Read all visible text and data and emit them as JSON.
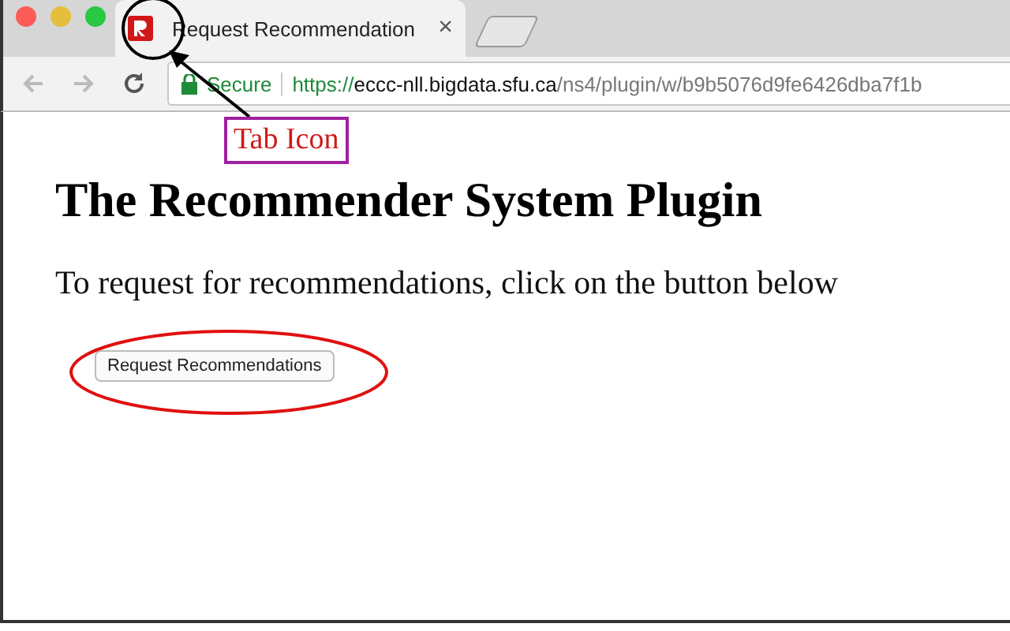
{
  "tab": {
    "title": "Request Recommendation",
    "close": "×",
    "selected": true
  },
  "address_bar": {
    "secure_label": "Secure",
    "url_scheme": "https://",
    "url_host": "eccc-nll.bigdata.sfu.ca",
    "url_path": "/ns4/plugin/w/b9b5076d9fe6426dba7f1b"
  },
  "page": {
    "heading": "The Recommender System Plugin",
    "text": "To request for recommendations, click on the button below",
    "button": "Request Recommendations"
  },
  "annotations": [
    {
      "kind": "circle"
    },
    {
      "kind": "arrow"
    },
    {
      "kind": "label",
      "text": "Tab Icon"
    },
    {
      "kind": "ellipse"
    }
  ]
}
